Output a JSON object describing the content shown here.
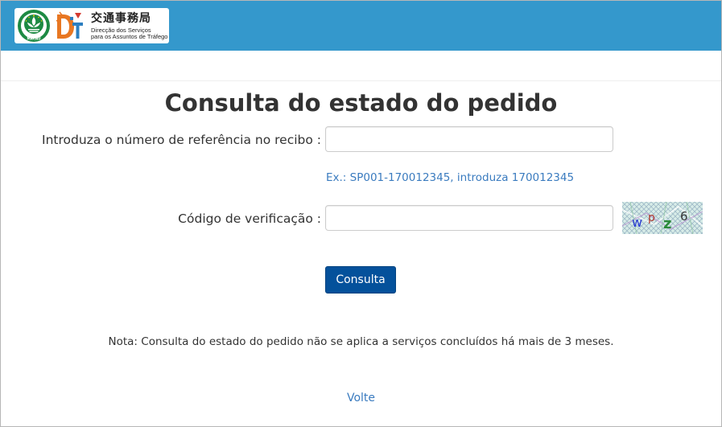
{
  "header": {
    "org_name_cn": "交通事務局",
    "org_name_pt_line1": "Direcção dos Serviços",
    "org_name_pt_line2": "para os Assuntos de Tráfego",
    "emblem_text": "MACAU",
    "bar_color": "#3498cc"
  },
  "page": {
    "title": "Consulta do estado do pedido"
  },
  "form": {
    "reference_label": "Introduza o número de referência no recibo :",
    "reference_value": "",
    "reference_hint": "Ex.: SP001-170012345, introduza 170012345",
    "code_label": "Código de verificação :",
    "code_value": "",
    "captcha_chars": [
      "w",
      "p",
      "z",
      "6"
    ],
    "submit_label": "Consulta",
    "submit_color": "#04519b"
  },
  "note": "Nota: Consulta do estado do pedido não se aplica a serviços concluídos há mais de 3 meses.",
  "back_link": "Volte",
  "link_color": "#3a7bbf"
}
